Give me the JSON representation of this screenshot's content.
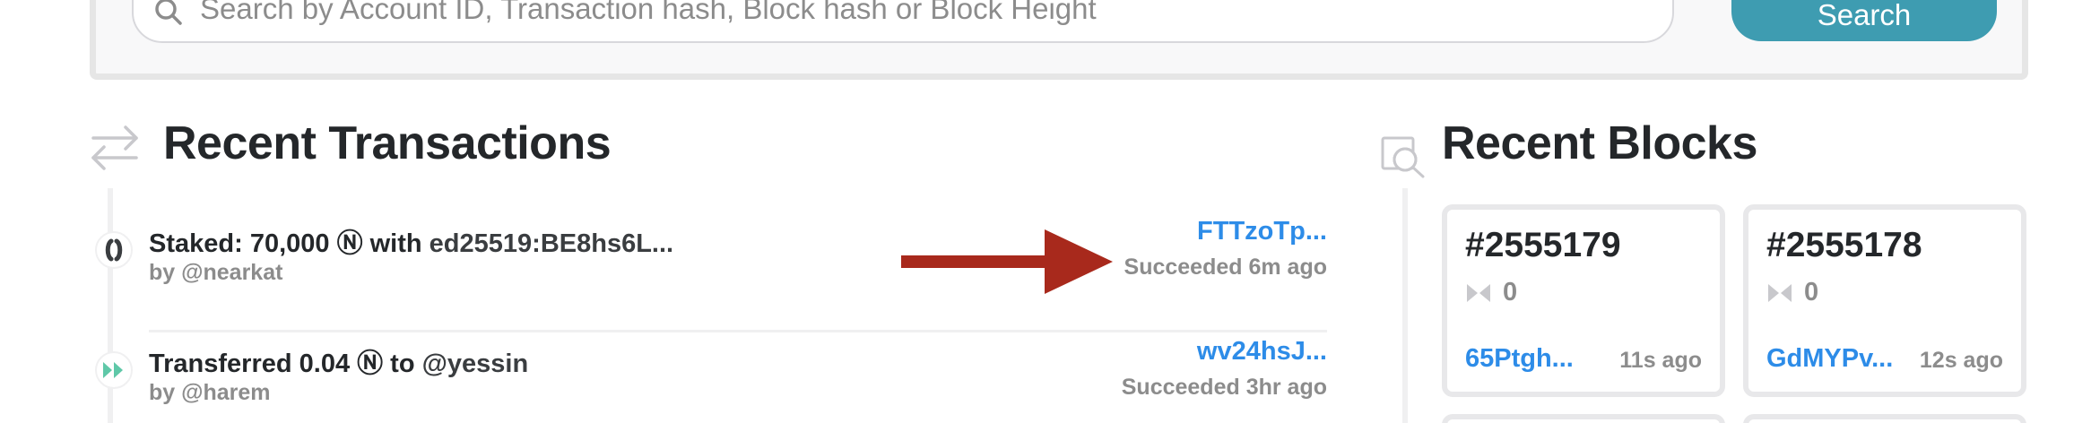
{
  "search": {
    "placeholder": "Search by Account ID, Transaction hash, Block hash or Block Height",
    "button_label": "Search",
    "icon": "search-icon"
  },
  "transactions": {
    "title": "Recent Transactions",
    "icon": "transfer-arrows-icon",
    "items": [
      {
        "icon": "stake-icon",
        "title_prefix": "Staked: 70,000 Ⓝ with ",
        "title_target": "ed25519:BE8hs6L...",
        "by": "by @nearkat",
        "hash": "FTTzoTp...",
        "status": "Succeeded 6m ago"
      },
      {
        "icon": "transfer-icon",
        "title_prefix": "Transferred 0.04 Ⓝ to ",
        "title_target": "@yessin",
        "by": "by @harem",
        "hash": "wv24hsJ...",
        "status": "Succeeded 3hr ago"
      }
    ]
  },
  "blocks": {
    "title": "Recent Blocks",
    "icon": "block-search-icon",
    "items": [
      {
        "number": "#2555179",
        "tx_count": "0",
        "hash": "65Ptgh...",
        "age": "11s ago"
      },
      {
        "number": "#2555178",
        "tx_count": "0",
        "hash": "GdMYPv...",
        "age": "12s ago"
      }
    ]
  },
  "colors": {
    "accent": "#3e9cb1",
    "link": "#2d8ce8",
    "annotation_arrow": "#a8291c",
    "muted": "#8c8c8c"
  }
}
